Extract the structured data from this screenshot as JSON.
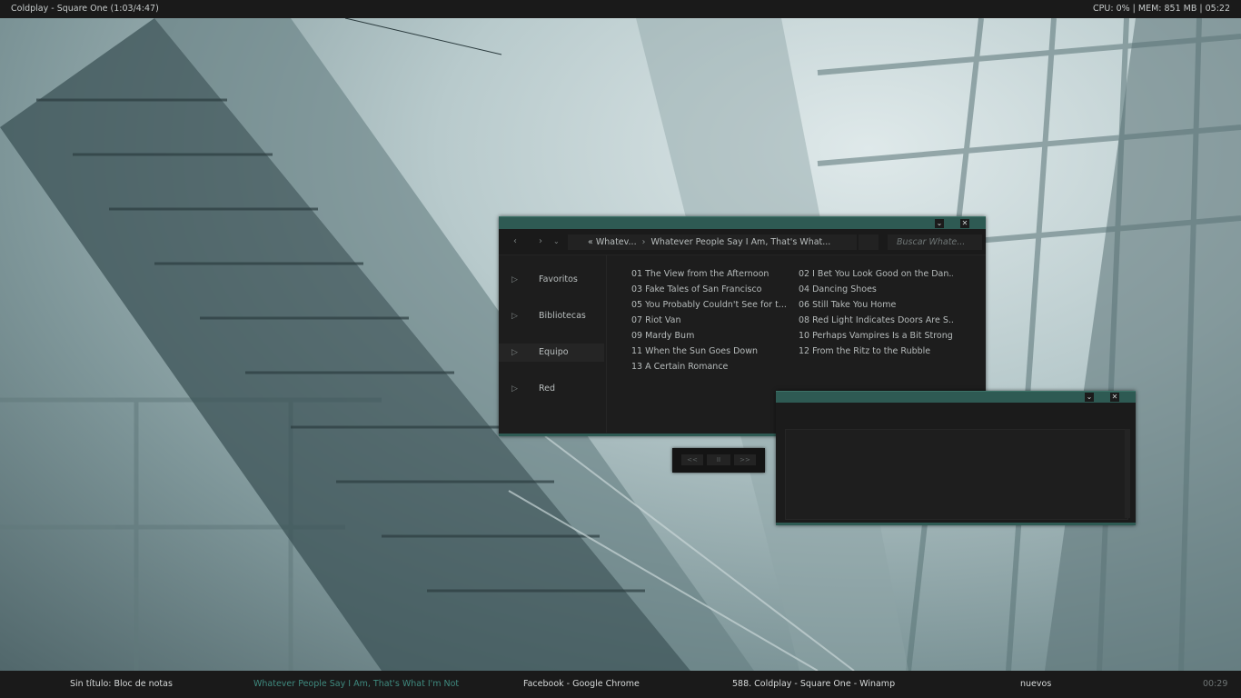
{
  "topbar": {
    "now_playing": "Coldplay - Square One  (1:03/4:47)",
    "stats": "CPU: 0% | MEM: 851 MB | 05:22"
  },
  "explorer": {
    "nav": {
      "back_icon": "chevron-left-icon",
      "forward_icon": "chevron-right-icon",
      "history_icon": "chevron-down-icon"
    },
    "breadcrumb": {
      "item1": "Whatev...",
      "item2": "Whatever People Say I Am, That's What..."
    },
    "search_placeholder": "Buscar Whate...",
    "sidebar": [
      {
        "label": "Favoritos"
      },
      {
        "label": "Bibliotecas"
      },
      {
        "label": "Equipo"
      },
      {
        "label": "Red"
      }
    ],
    "files": [
      "01 The View from the Afternoon",
      "02 I Bet You Look Good on the Dan...",
      "03 Fake Tales of San Francisco",
      "04 Dancing Shoes",
      "05 You Probably Couldn't See for t...",
      "06 Still Take You Home",
      "07 Riot Van",
      "08 Red Light Indicates Doors Are S...",
      "09 Mardy Bum",
      "10 Perhaps Vampires Is a Bit Strong...",
      "11 When the Sun Goes Down",
      "12 From the Ritz to the Rubble",
      "13 A Certain Romance"
    ]
  },
  "mini_player": {
    "prev": "<<",
    "pause": "II",
    "next": ">>"
  },
  "taskbar": {
    "items": [
      "Sin título: Bloc de notas",
      "Whatever People Say I Am, That's What I'm Not",
      "Facebook - Google Chrome",
      "588. Coldplay - Square One - Winamp",
      "nuevos"
    ],
    "clock": "00:29",
    "accent": "#3f8a7f"
  }
}
